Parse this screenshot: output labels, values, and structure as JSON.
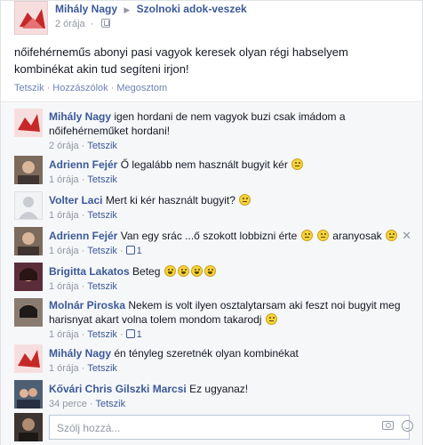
{
  "post": {
    "author": "Mihály Nagy",
    "group": "Szolnoki adok-veszek",
    "time": "2 órája",
    "text": "nőifehérneműs abonyi pasi vagyok keresek olyan régi habselyem kombinékat akin tud segíteni irjon!",
    "actions": {
      "like": "Tetszik",
      "comment": "Hozzászólok",
      "share": "Megosztom"
    }
  },
  "comments": [
    {
      "author": "Mihály Nagy",
      "text": "igen hordani de nem vagyok buzi csak imádom a nőifehérneműket hordani!",
      "time": "2 órája",
      "like": "Tetszik"
    },
    {
      "author": "Adrienn Fejér",
      "text": "Ő legalább nem használt bugyit kér",
      "time": "1 órája",
      "like": "Tetszik"
    },
    {
      "author": "Volter Laci",
      "text": "Mert ki kér használt bugyit?",
      "time": "1 órája",
      "like": "Tetszik"
    },
    {
      "author": "Adrienn Fejér",
      "text": "Van egy srác ...ő szokott lobbizni érte",
      "text2": "aranyosak",
      "time": "1 órája",
      "like": "Tetszik",
      "likes": "1"
    },
    {
      "author": "Brigitta Lakatos",
      "text": "Beteg",
      "time": "1 órája",
      "like": "Tetszik"
    },
    {
      "author": "Molnár Piroska",
      "text": "Nekem is volt ilyen osztalytarsam aki feszt noi bugyit meg harisnyat akart volna tolem mondom takarodj",
      "time": "1 órája",
      "like": "Tetszik",
      "likes": "1"
    },
    {
      "author": "Mihály Nagy",
      "text": "én tényleg szeretnék olyan kombinékat",
      "time": "1 órája",
      "like": "Tetszik"
    },
    {
      "author": "Kővári Chris Gilszki Marcsi",
      "text": "Ez ugyanaz!",
      "time": "34 perce",
      "like": "Tetszik"
    }
  ],
  "reply": {
    "placeholder": "Szólj hozzá..."
  },
  "colors": {
    "link": "#3b5998",
    "meta": "#9197a3",
    "comment_bg": "#f6f7f9"
  },
  "icons": [
    "globe-icon",
    "close-icon",
    "like-icon",
    "camera-icon",
    "emoji-icon"
  ]
}
